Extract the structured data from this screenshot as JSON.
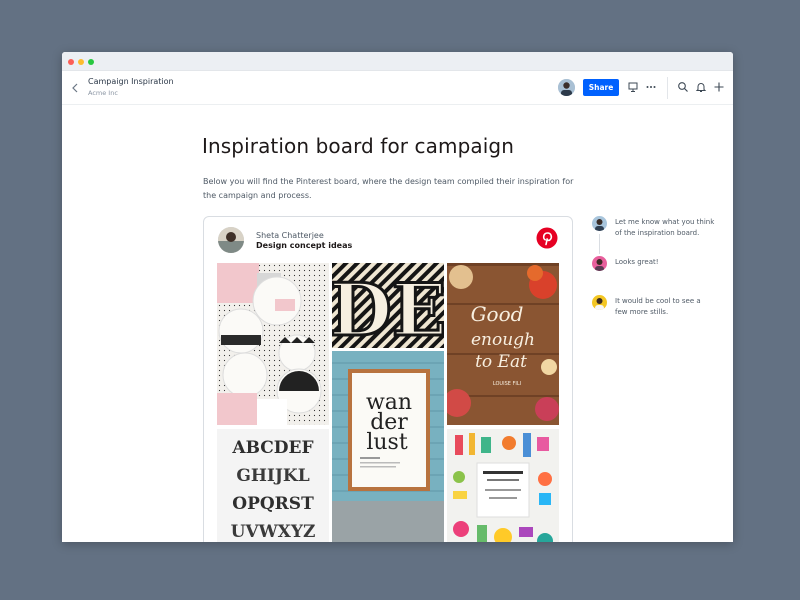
{
  "window": {
    "doc_title": "Campaign Inspiration",
    "doc_subtitle": "Acme Inc",
    "share_label": "Share"
  },
  "header_icons": [
    "back-chevron-icon",
    "present-icon",
    "more-icon",
    "search-icon",
    "bell-icon",
    "plus-icon"
  ],
  "page": {
    "title": "Inspiration board for campaign",
    "description": "Below you will find the Pinterest board, where the design team compiled their inspiration for the campaign and process."
  },
  "embed": {
    "author": "Sheta Chatterjee",
    "board": "Design concept ideas",
    "tile_texts": {
      "de": "DE",
      "good": "Good",
      "enough": "enough",
      "to_eat": "to Eat",
      "louise": "LOUISE FILI",
      "wan": "wan",
      "der": "der",
      "lust": "lust",
      "alpha1": "ABCDEF",
      "alpha2": "GHIJKL",
      "alpha3": "OPQRST",
      "alpha4": "UVWXYZ"
    }
  },
  "comments": [
    {
      "text": "Let me know what you think of the inspiration board."
    },
    {
      "text": "Looks great!"
    },
    {
      "text": "It would be cool to see a few more stills."
    }
  ],
  "colors": {
    "background": "#637183",
    "accent": "#0061fe",
    "pinterest": "#e60023"
  }
}
